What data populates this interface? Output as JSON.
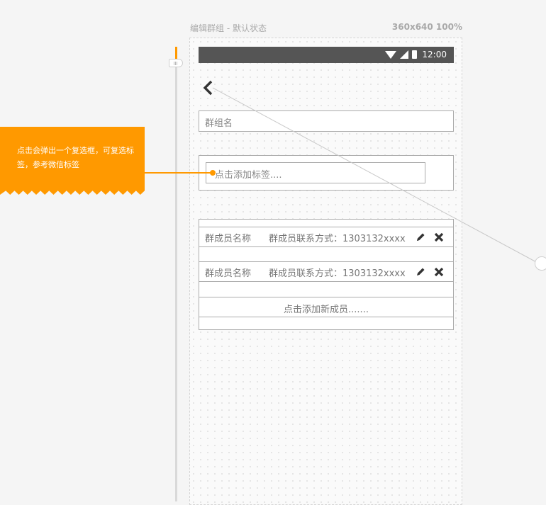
{
  "frame": {
    "title": "编辑群组 - 默认状态",
    "size": "360x640 100%"
  },
  "statusbar": {
    "time": "12:00",
    "icons": [
      "wifi-icon",
      "signal-icon",
      "battery-icon"
    ]
  },
  "form": {
    "group_name_placeholder": "群组名",
    "tag_placeholder": "点击添加标签...."
  },
  "members": [
    {
      "name": "群成员名称",
      "contact": "群成员联系方式：1303132xxxx"
    },
    {
      "name": "群成员名称",
      "contact": "群成员联系方式：1303132xxxx"
    }
  ],
  "add_member_label": "点击添加新成员.......",
  "annotation": {
    "text": "点击会弹出一个复选框，可复选标签，参考微信标签"
  },
  "colors": {
    "accent": "#ff9900",
    "statusbar": "#555555",
    "border": "#ababab"
  }
}
